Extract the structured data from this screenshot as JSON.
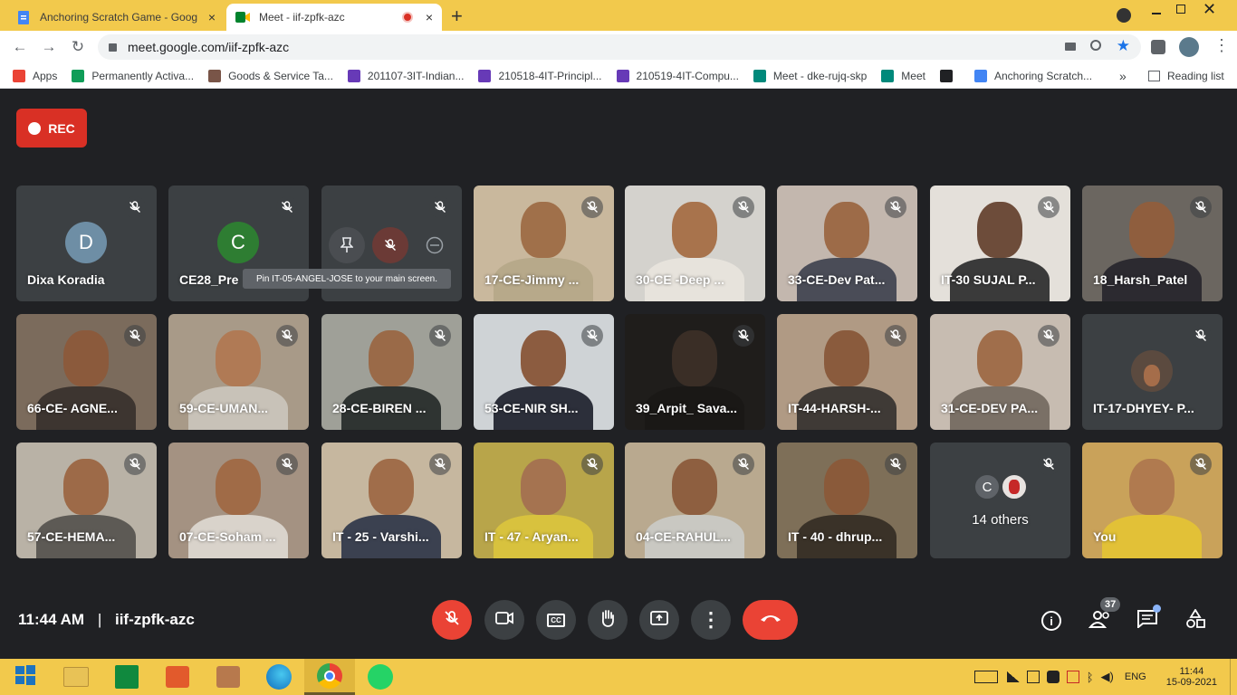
{
  "browser": {
    "tabs": [
      {
        "title": "Anchoring Scratch Game - Goog",
        "close": "×"
      },
      {
        "title": "Meet - iif-zpfk-azc",
        "close": "×"
      }
    ],
    "new_tab": "+",
    "url": "meet.google.com/iif-zpfk-azc",
    "bookmarks": [
      {
        "label": "Apps",
        "color": "#ea4335"
      },
      {
        "label": "Permanently Activa...",
        "color": "#0f9d58"
      },
      {
        "label": "Goods & Service Ta...",
        "color": "#795548"
      },
      {
        "label": "201107-3IT-Indian...",
        "color": "#673ab7"
      },
      {
        "label": "210518-4IT-Principl...",
        "color": "#673ab7"
      },
      {
        "label": "210519-4IT-Compu...",
        "color": "#673ab7"
      },
      {
        "label": "Meet - dke-rujq-skp",
        "color": "#00897b"
      },
      {
        "label": "Meet",
        "color": "#00897b"
      },
      {
        "label": "",
        "color": "#202124"
      },
      {
        "label": "Anchoring Scratch...",
        "color": "#4285f4"
      }
    ],
    "more": "»",
    "reading_list": "Reading list"
  },
  "meet": {
    "rec_label": "REC",
    "tooltip": "Pin IT-05-ANGEL-JOSE to your main screen.",
    "time": "11:44 AM",
    "separator": "|",
    "code": "iif-zpfk-azc",
    "participant_count": "37",
    "participants": [
      {
        "name": "Dixa Koradia",
        "initial": "D",
        "avatar_color": "#6e8ea5"
      },
      {
        "name": "CE28_Pre",
        "initial": "C",
        "avatar_color": "#2e7d32"
      },
      {
        "name": "",
        "initial": "",
        "avatar_color": ""
      },
      {
        "name": "17-CE-Jimmy ...",
        "bg": "#c9b89d",
        "skin": "#a0704a",
        "shirt": "#b7a98a"
      },
      {
        "name": "30-CE -Deep ...",
        "bg": "#d4d2cd",
        "skin": "#a8734c",
        "shirt": "#e7e3dc"
      },
      {
        "name": "33-CE-Dev Pat...",
        "bg": "#c3b7ae",
        "skin": "#9d6b48",
        "shirt": "#4a4c57"
      },
      {
        "name": "IT-30 SUJAL P...",
        "bg": "#e4e0da",
        "skin": "#6d4c3a",
        "shirt": "#3a3a3a"
      },
      {
        "name": "18_Harsh_Patel",
        "bg": "#6b6660",
        "skin": "#8f5e3e",
        "shirt": "#2c2a30"
      },
      {
        "name": "66-CE- AGNE...",
        "bg": "#7b6b5c",
        "skin": "#8b5a3c",
        "shirt": "#3d3530"
      },
      {
        "name": "59-CE-UMAN...",
        "bg": "#a89a88",
        "skin": "#b07a55",
        "shirt": "#c8c2b8"
      },
      {
        "name": "28-CE-BIREN ...",
        "bg": "#9fa098",
        "skin": "#9a6a48",
        "shirt": "#2f3432"
      },
      {
        "name": "53-CE-NIR SH...",
        "bg": "#cfd3d6",
        "skin": "#8c5c40",
        "shirt": "#2c2f3a"
      },
      {
        "name": "39_Arpit_ Sava...",
        "bg": "#1f1d1b",
        "skin": "#3a2e26",
        "shirt": "#1a1816"
      },
      {
        "name": "IT-44-HARSH-...",
        "bg": "#b09a84",
        "skin": "#8a5b3d",
        "shirt": "#3f3a36"
      },
      {
        "name": "31-CE-DEV PA...",
        "bg": "#c7bcb1",
        "skin": "#a06e4b",
        "shirt": "#7a7066"
      },
      {
        "name": "IT-17-DHYEY- P...",
        "initial": "",
        "avatar_color": "#5b4a3f"
      },
      {
        "name": "57-CE-HEMA...",
        "bg": "#b9b2a6",
        "skin": "#9d6a48",
        "shirt": "#5d5a55"
      },
      {
        "name": "07-CE-Soham ...",
        "bg": "#a49282",
        "skin": "#a06b47",
        "shirt": "#d9d3cb"
      },
      {
        "name": "IT - 25 - Varshi...",
        "bg": "#c6b79f",
        "skin": "#a06d4a",
        "shirt": "#3b4150"
      },
      {
        "name": "IT - 47 - Aryan...",
        "bg": "#b8a54a",
        "skin": "#a57350",
        "shirt": "#d8c23e"
      },
      {
        "name": "04-CE-RAHUL...",
        "bg": "#b9a98f",
        "skin": "#8e5f40",
        "shirt": "#c9c8c2"
      },
      {
        "name": "IT - 40 - dhrup...",
        "bg": "#7e6f58",
        "skin": "#8a5a3a",
        "shirt": "#3a3228"
      },
      {
        "name": "14 others",
        "initial": "C",
        "avatar_color": "#5f6368"
      },
      {
        "name": "You",
        "bg": "#c9a25a",
        "skin": "#b07a4f",
        "shirt": "#e2c137"
      }
    ]
  },
  "taskbar": {
    "lang": "ENG",
    "time": "11:44",
    "date": "15-09-2021"
  }
}
